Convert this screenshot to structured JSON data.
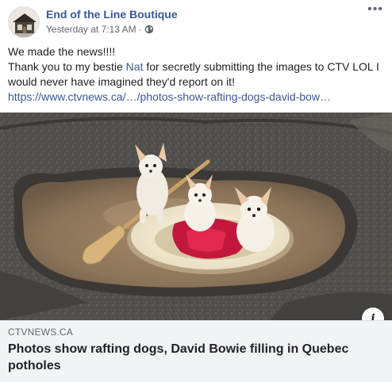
{
  "post": {
    "page_name": "End of the Line Boutique",
    "timestamp": "Yesterday at 7:13 AM",
    "separator": "·",
    "privacy_icon": "globe-icon",
    "more_icon": "more-options-icon",
    "more_label": "•••",
    "text": {
      "line1": "We made the news!!!!",
      "line2_before": "Thank you to my bestie ",
      "mention": "Nat",
      "line2_after": " for secretly submitting the images to CTV LOL I",
      "line3": "would never have imagined they'd report on it!",
      "link": "https://www.ctvnews.ca/…/photos-show-rafting-dogs-david-bow…"
    }
  },
  "link_preview": {
    "domain": "CTVNEWS.CA",
    "headline_line1": "Photos show rafting dogs, David Bowie filling in Quebec",
    "headline_line2": "potholes",
    "info_label": "i",
    "info_icon": "info-icon"
  },
  "colors": {
    "link_blue": "#385898",
    "meta_gray": "#616770",
    "preview_bg": "#f2f3f5"
  }
}
